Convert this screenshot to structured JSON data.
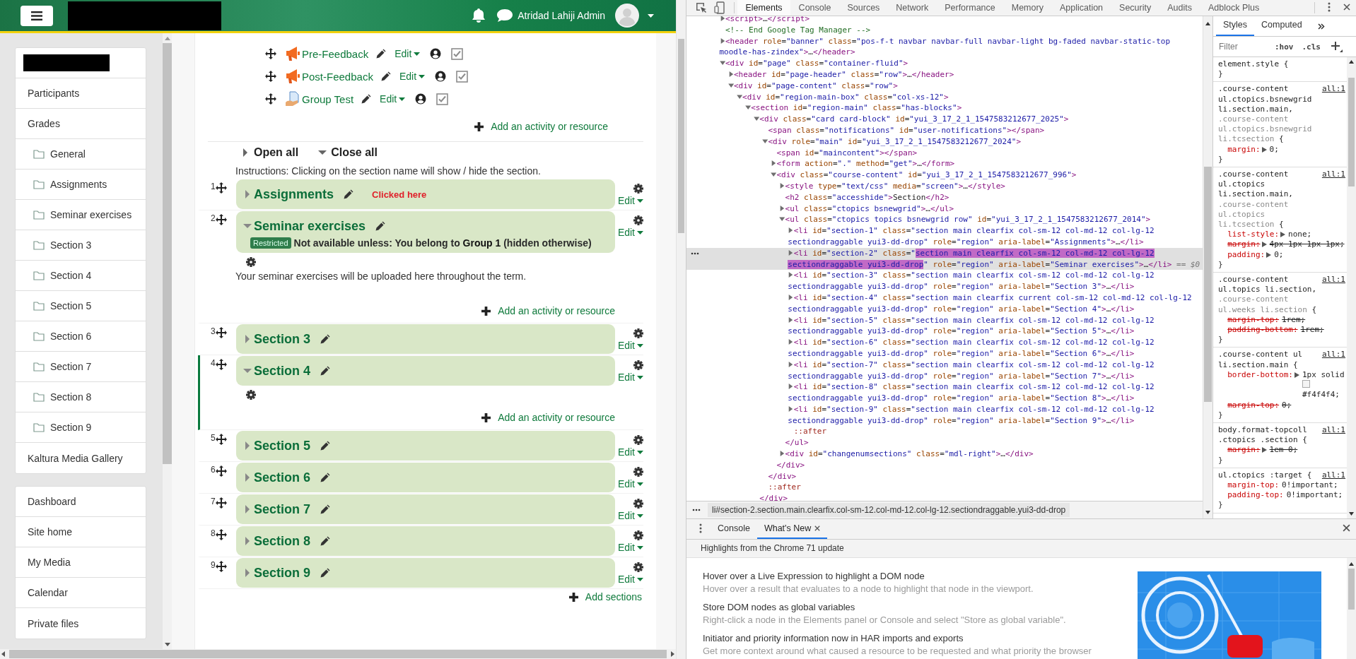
{
  "navbar": {
    "user_name": "Atridad Lahiji Admin"
  },
  "sidebar": {
    "cards": [
      {
        "items": [
          {
            "label": "Participants",
            "kind": "link"
          },
          {
            "label": "Grades",
            "kind": "link"
          },
          {
            "label": "General",
            "kind": "folder"
          },
          {
            "label": "Assignments",
            "kind": "folder"
          },
          {
            "label": "Seminar exercises",
            "kind": "folder"
          },
          {
            "label": "Section 3",
            "kind": "folder"
          },
          {
            "label": "Section 4",
            "kind": "folder"
          },
          {
            "label": "Section 5",
            "kind": "folder"
          },
          {
            "label": "Section 6",
            "kind": "folder"
          },
          {
            "label": "Section 7",
            "kind": "folder"
          },
          {
            "label": "Section 8",
            "kind": "folder"
          },
          {
            "label": "Section 9",
            "kind": "folder"
          },
          {
            "label": "Kaltura Media Gallery",
            "kind": "link"
          }
        ]
      },
      {
        "items": [
          {
            "label": "Dashboard",
            "kind": "link"
          },
          {
            "label": "Site home",
            "kind": "link"
          },
          {
            "label": "My Media",
            "kind": "link"
          },
          {
            "label": "Calendar",
            "kind": "link"
          },
          {
            "label": "Private files",
            "kind": "link"
          }
        ]
      }
    ]
  },
  "course": {
    "activities": [
      {
        "name": "Pre-Feedback",
        "kind": "feedback",
        "edit_label": "Edit"
      },
      {
        "name": "Post-Feedback",
        "kind": "feedback",
        "edit_label": "Edit"
      },
      {
        "name": "Group Test",
        "kind": "test",
        "edit_label": "Edit"
      }
    ],
    "add_activity": "Add an activity or resource",
    "open_all": "Open all",
    "close_all": "Close all",
    "instructions": "Instructions: Clicking on the section name will show / hide the section.",
    "sections": [
      {
        "number": "1",
        "title": "Assignments",
        "expanded": false,
        "current": false,
        "annotation": "Clicked here",
        "edit_label": "Edit"
      },
      {
        "number": "2",
        "title": "Seminar exercises",
        "expanded": true,
        "current": false,
        "badge": "Restricted",
        "restriction": "Not available unless: You belong to **Group 1** (hidden otherwise)",
        "summary": "Your seminar exercises will be uploaded here throughout the term.",
        "add_activity": "Add an activity or resource",
        "edit_label": "Edit"
      },
      {
        "number": "3",
        "title": "Section 3",
        "expanded": false,
        "current": false,
        "edit_label": "Edit"
      },
      {
        "number": "4",
        "title": "Section 4",
        "expanded": true,
        "current": true,
        "add_activity": "Add an activity or resource",
        "edit_label": "Edit"
      },
      {
        "number": "5",
        "title": "Section 5",
        "expanded": false,
        "current": false,
        "edit_label": "Edit"
      },
      {
        "number": "6",
        "title": "Section 6",
        "expanded": false,
        "current": false,
        "edit_label": "Edit"
      },
      {
        "number": "7",
        "title": "Section 7",
        "expanded": false,
        "current": false,
        "edit_label": "Edit"
      },
      {
        "number": "8",
        "title": "Section 8",
        "expanded": false,
        "current": false,
        "edit_label": "Edit"
      },
      {
        "number": "9",
        "title": "Section 9",
        "expanded": false,
        "current": false,
        "edit_label": "Edit"
      }
    ],
    "add_sections": "Add sections"
  },
  "devtools": {
    "tabs": [
      {
        "label": "Elements",
        "selected": true
      },
      {
        "label": "Console",
        "selected": false
      },
      {
        "label": "Sources",
        "selected": false
      },
      {
        "label": "Network",
        "selected": false
      },
      {
        "label": "Performance",
        "selected": false
      },
      {
        "label": "Memory",
        "selected": false
      },
      {
        "label": "Application",
        "selected": false
      },
      {
        "label": "Security",
        "selected": false
      },
      {
        "label": "Audits",
        "selected": false
      },
      {
        "label": "Adblock Plus",
        "selected": false
      }
    ],
    "dom_tree": [
      {
        "kind": "closed",
        "selected": false,
        "text": "<script>…</script>"
      },
      {
        "kind": "leaf",
        "selected": false,
        "text": "<!-- End Google Tag Manager -->"
      },
      {
        "kind": "closed",
        "selected": false,
        "text": "<header role=\"banner\" class=\"pos-f-t navbar navbar-full navbar-light bg-faded navbar-static-top moodle-has-zindex\">…</header>"
      },
      {
        "kind": "open",
        "selected": false,
        "text": "<div id=\"page\" class=\"container-fluid\">",
        "children": [
          {
            "kind": "closed",
            "selected": false,
            "text": "<header id=\"page-header\" class=\"row\">…</header>"
          },
          {
            "kind": "open",
            "selected": false,
            "text": "<div id=\"page-content\" class=\"row\">",
            "children": [
              {
                "kind": "open",
                "selected": false,
                "text": "<div id=\"region-main-box\" class=\"col-xs-12\">",
                "children": [
                  {
                    "kind": "open",
                    "selected": false,
                    "text": "<section id=\"region-main\" class=\"has-blocks\">",
                    "children": [
                      {
                        "kind": "open",
                        "selected": false,
                        "text": "<div class=\"card card-block\" id=\"yui_3_17_2_1_1547583212677_2025\">",
                        "closing": "</div>",
                        "children": [
                          {
                            "kind": "leaf",
                            "selected": false,
                            "text": "<span class=\"notifications\" id=\"user-notifications\"></span>"
                          },
                          {
                            "kind": "open",
                            "selected": false,
                            "text": "<div role=\"main\" id=\"yui_3_17_2_1_1547583212677_2024\">",
                            "closing": "</div>",
                            "children": [
                              {
                                "kind": "leaf",
                                "selected": false,
                                "text": "<span id=\"maincontent\"></span>"
                              },
                              {
                                "kind": "closed",
                                "selected": false,
                                "text": "<form action=\".\" method=\"get\">…</form>"
                              },
                              {
                                "kind": "open",
                                "selected": false,
                                "text": "<div class=\"course-content\" id=\"yui_3_17_2_1_1547583212677_996\">",
                                "closing": "</div>",
                                "children": [
                                  {
                                    "kind": "closed",
                                    "selected": false,
                                    "text": "<style type=\"text/css\" media=\"screen\">…</style>"
                                  },
                                  {
                                    "kind": "leaf",
                                    "selected": false,
                                    "text": "<h2 class=\"accesshide\">Section</h2>"
                                  },
                                  {
                                    "kind": "closed",
                                    "selected": false,
                                    "text": "<ul class=\"ctopics bsnewgrid\">…</ul>"
                                  },
                                  {
                                    "kind": "open",
                                    "selected": false,
                                    "text": "<ul class=\"ctopics topics bsnewgrid row\" id=\"yui_3_17_2_1_1547583212677_2014\">",
                                    "closing": "</ul>",
                                    "children": [
                                      {
                                        "kind": "closed",
                                        "selected": false,
                                        "text": "<li id=\"section-1\" class=\"section main clearfix col-sm-12 col-md-12 col-lg-12 sectiondraggable yui3-dd-drop\" role=\"region\" aria-label=\"Assignments\">…</li>"
                                      },
                                      {
                                        "kind": "closed",
                                        "selected": true,
                                        "parts": [
                                          "<li id=\"section-2\" class=\"",
                                          "section main clearfix col-sm-12 col-md-12 col-lg-12 sectiondraggable yui3-dd-drop",
                                          "\" role=\"region\" aria-label=\"Seminar exercises\">…</li>"
                                        ],
                                        "console_ref": "== $0"
                                      },
                                      {
                                        "kind": "closed",
                                        "selected": false,
                                        "text": "<li id=\"section-3\" class=\"section main clearfix col-sm-12 col-md-12 col-lg-12 sectiondraggable yui3-dd-drop\" role=\"region\" aria-label=\"Section 3\">…</li>"
                                      },
                                      {
                                        "kind": "closed",
                                        "selected": false,
                                        "text": "<li id=\"section-4\" class=\"section main clearfix current col-sm-12 col-md-12 col-lg-12 sectiondraggable yui3-dd-drop\" role=\"region\" aria-label=\"Section 4\">…</li>"
                                      },
                                      {
                                        "kind": "closed",
                                        "selected": false,
                                        "text": "<li id=\"section-5\" class=\"section main clearfix col-sm-12 col-md-12 col-lg-12 sectiondraggable yui3-dd-drop\" role=\"region\" aria-label=\"Section 5\">…</li>"
                                      },
                                      {
                                        "kind": "closed",
                                        "selected": false,
                                        "text": "<li id=\"section-6\" class=\"section main clearfix col-sm-12 col-md-12 col-lg-12 sectiondraggable yui3-dd-drop\" role=\"region\" aria-label=\"Section 6\">…</li>"
                                      },
                                      {
                                        "kind": "closed",
                                        "selected": false,
                                        "text": "<li id=\"section-7\" class=\"section main clearfix col-sm-12 col-md-12 col-lg-12 sectiondraggable yui3-dd-drop\" role=\"region\" aria-label=\"Section 7\">…</li>"
                                      },
                                      {
                                        "kind": "closed",
                                        "selected": false,
                                        "text": "<li id=\"section-8\" class=\"section main clearfix col-sm-12 col-md-12 col-lg-12 sectiondraggable yui3-dd-drop\" role=\"region\" aria-label=\"Section 8\">…</li>"
                                      },
                                      {
                                        "kind": "closed",
                                        "selected": false,
                                        "text": "<li id=\"section-9\" class=\"section main clearfix col-sm-12 col-md-12 col-lg-12 sectiondraggable yui3-dd-drop\" role=\"region\" aria-label=\"Section 9\">…</li>"
                                      },
                                      {
                                        "kind": "pseudo",
                                        "selected": false,
                                        "text": "::after"
                                      }
                                    ]
                                  },
                                  {
                                    "kind": "closed",
                                    "selected": false,
                                    "text": "<div id=\"changenumsections\" class=\"mdl-right\">…</div>"
                                  }
                                ]
                              }
                            ]
                          },
                          {
                            "kind": "pseudo",
                            "selected": false,
                            "text": "::after"
                          }
                        ]
                      }
                    ]
                  }
                ]
              }
            ]
          }
        ]
      }
    ],
    "breadcrumb": "li#section-2.section.main.clearfix.col-sm-12.col-md-12.col-lg-12.sectiondraggable.yui3-dd-drop",
    "styles_tabs": [
      {
        "label": "Styles",
        "selected": true
      },
      {
        "label": "Computed",
        "selected": false
      }
    ],
    "filter_placeholder": "Filter",
    "hov_label": ":hov",
    "cls_label": ".cls",
    "rules": [
      {
        "selector": [
          {
            "text": "element.style",
            "matched": true
          }
        ],
        "open_brace": "{",
        "close_brace": "}"
      },
      {
        "selector": [
          {
            "text": ".course-content ul.ctopics.bsnewgrid li.section.main,",
            "matched": true
          },
          {
            "text": ".course-content ul.ctopics.bsnewgrid li.tcsection",
            "matched": false
          }
        ],
        "open_brace": "{",
        "close_brace": "}",
        "source": "all:1",
        "declarations": [
          {
            "property": "margin:",
            "expandable": true,
            "value": "0;",
            "overridden": false
          }
        ]
      },
      {
        "selector": [
          {
            "text": ".course-content ul.ctopics li.section.main,",
            "matched": true
          },
          {
            "text": ".course-content ul.ctopics li.tcsection",
            "matched": false
          }
        ],
        "open_brace": "{",
        "close_brace": "}",
        "source": "all:1",
        "declarations": [
          {
            "property": "list-style:",
            "expandable": true,
            "value": "none;",
            "overridden": false
          },
          {
            "property": "margin:",
            "expandable": true,
            "value": "4px 1px 1px 1px;",
            "overridden": true
          },
          {
            "property": "padding:",
            "expandable": true,
            "value": "0;",
            "overridden": false
          }
        ]
      },
      {
        "selector": [
          {
            "text": ".course-content ul.topics li.section,",
            "matched": true
          },
          {
            "text": ".course-content ul.weeks li.section",
            "matched": false
          }
        ],
        "open_brace": "{",
        "close_brace": "}",
        "source": "all:1",
        "declarations": [
          {
            "property": "margin-top:",
            "expandable": false,
            "value": "1rem;",
            "overridden": true
          },
          {
            "property": "padding-bottom:",
            "expandable": false,
            "value": "1rem;",
            "overridden": true
          }
        ]
      },
      {
        "selector": [
          {
            "text": ".course-content ul li.section.main",
            "matched": true
          }
        ],
        "open_brace": "{",
        "close_brace": "}",
        "source": "all:1",
        "declarations": [
          {
            "property": "border-bottom:",
            "expandable": true,
            "value": "1px solid",
            "color": "#f4f4f4",
            "color_text": "#f4f4f4;",
            "overridden": false
          },
          {
            "property": "margin-top:",
            "expandable": false,
            "value": "0;",
            "overridden": true
          }
        ]
      },
      {
        "selector": [
          {
            "text": "body.format-topcoll .ctopics .section",
            "matched": true
          }
        ],
        "open_brace": "{",
        "close_brace": "}",
        "source": "all:1",
        "declarations": [
          {
            "property": "margin:",
            "expandable": true,
            "value": "1em 0;",
            "overridden": true
          }
        ]
      },
      {
        "selector": [
          {
            "text": "ul.ctopics :target",
            "matched": true
          }
        ],
        "open_brace": "{",
        "close_brace": "}",
        "source": "all:1",
        "declarations": [
          {
            "property": "margin-top:",
            "expandable": false,
            "value": "0!important;",
            "overridden": false
          },
          {
            "property": "padding-top:",
            "expandable": false,
            "value": "0!important;",
            "overridden": false
          }
        ]
      }
    ],
    "drawer": {
      "tabs": [
        {
          "label": "Console",
          "selected": false,
          "closable": false
        },
        {
          "label": "What's New",
          "selected": true,
          "closable": true
        }
      ],
      "heading": "Highlights from the Chrome 71 update",
      "items": [
        {
          "title": "Hover over a Live Expression to highlight a DOM node",
          "description": "Hover over a result that evaluates to a node to highlight that node in the viewport."
        },
        {
          "title": "Store DOM nodes as global variables",
          "description": "Right-click a node in the Elements panel or Console and select \"Store as global variable\"."
        },
        {
          "title": "Initiator and priority information now in HAR imports and exports",
          "description": "Get more context around what caused a resource to be requested and what priority the browser"
        }
      ]
    }
  }
}
